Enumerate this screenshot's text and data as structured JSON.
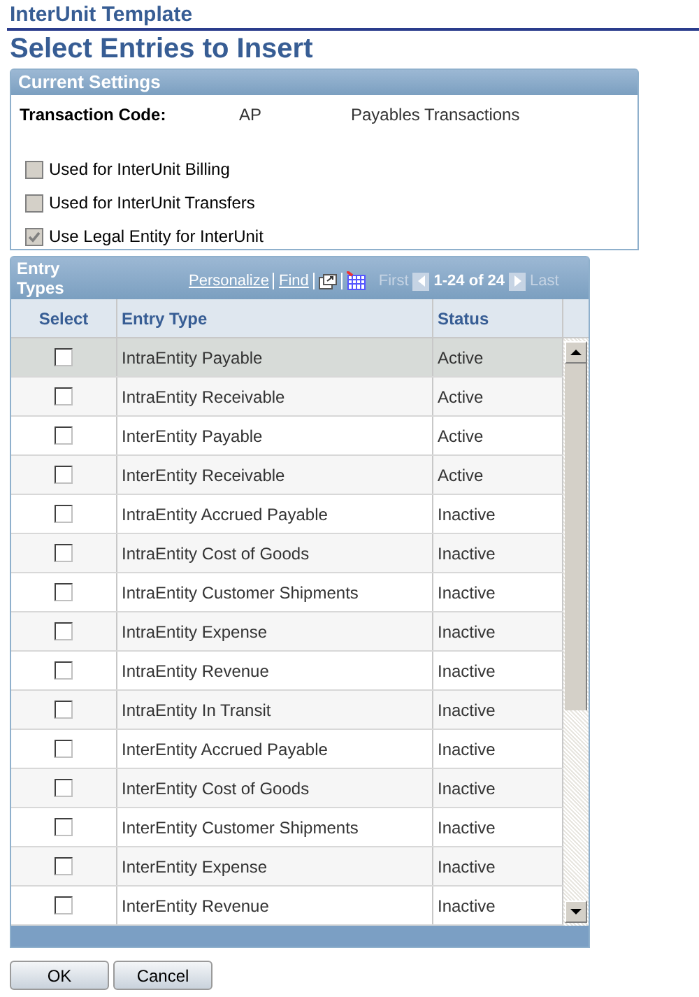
{
  "page_title": "InterUnit Template",
  "heading": "Select Entries to Insert",
  "current_settings": {
    "title": "Current Settings",
    "transaction_code": {
      "label": "Transaction Code:",
      "code": "AP",
      "description": "Payables Transactions"
    },
    "options": [
      {
        "label": "Used for InterUnit Billing",
        "checked": false
      },
      {
        "label": "Used for InterUnit Transfers",
        "checked": false
      },
      {
        "label": "Use Legal Entity for InterUnit",
        "checked": true
      }
    ]
  },
  "grid": {
    "title": "Entry Types",
    "personalize": "Personalize",
    "find": "Find",
    "first": "First",
    "range": "1-24 of 24",
    "last": "Last",
    "columns": [
      "Select",
      "Entry Type",
      "Status"
    ],
    "rows": [
      {
        "checked": false,
        "entry_type": "IntraEntity Payable",
        "status": "Active",
        "selected": true
      },
      {
        "checked": false,
        "entry_type": "IntraEntity Receivable",
        "status": "Active",
        "selected": false
      },
      {
        "checked": false,
        "entry_type": "InterEntity Payable",
        "status": "Active",
        "selected": false
      },
      {
        "checked": false,
        "entry_type": "InterEntity Receivable",
        "status": "Active",
        "selected": false
      },
      {
        "checked": false,
        "entry_type": "IntraEntity Accrued Payable",
        "status": "Inactive",
        "selected": false
      },
      {
        "checked": false,
        "entry_type": "IntraEntity Cost of Goods",
        "status": "Inactive",
        "selected": false
      },
      {
        "checked": false,
        "entry_type": "IntraEntity Customer Shipments",
        "status": "Inactive",
        "selected": false
      },
      {
        "checked": false,
        "entry_type": "IntraEntity Expense",
        "status": "Inactive",
        "selected": false
      },
      {
        "checked": false,
        "entry_type": "IntraEntity Revenue",
        "status": "Inactive",
        "selected": false
      },
      {
        "checked": false,
        "entry_type": "IntraEntity In Transit",
        "status": "Inactive",
        "selected": false
      },
      {
        "checked": false,
        "entry_type": "InterEntity Accrued Payable",
        "status": "Inactive",
        "selected": false
      },
      {
        "checked": false,
        "entry_type": "InterEntity Cost of Goods",
        "status": "Inactive",
        "selected": false
      },
      {
        "checked": false,
        "entry_type": "InterEntity Customer Shipments",
        "status": "Inactive",
        "selected": false
      },
      {
        "checked": false,
        "entry_type": "InterEntity Expense",
        "status": "Inactive",
        "selected": false
      },
      {
        "checked": false,
        "entry_type": "InterEntity Revenue",
        "status": "Inactive",
        "selected": false
      }
    ]
  },
  "buttons": [
    "OK",
    "Cancel"
  ]
}
